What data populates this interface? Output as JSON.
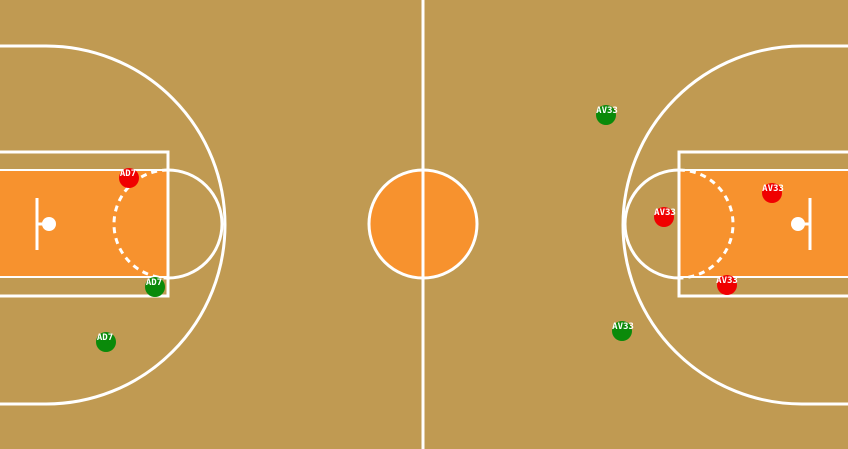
{
  "colors": {
    "floor": "#c09a52",
    "paint": "#f7922e",
    "lines": "#ffffff",
    "team_red": "#f00000",
    "team_green": "#0a8a0a"
  },
  "players": [
    {
      "label": "AD7",
      "team": "red"
    },
    {
      "label": "AD7",
      "team": "green"
    },
    {
      "label": "AD7",
      "team": "green"
    },
    {
      "label": "AV33",
      "team": "green"
    },
    {
      "label": "AV33",
      "team": "red"
    },
    {
      "label": "AV33",
      "team": "red"
    },
    {
      "label": "AV33",
      "team": "red"
    },
    {
      "label": "AV33",
      "team": "green"
    }
  ]
}
